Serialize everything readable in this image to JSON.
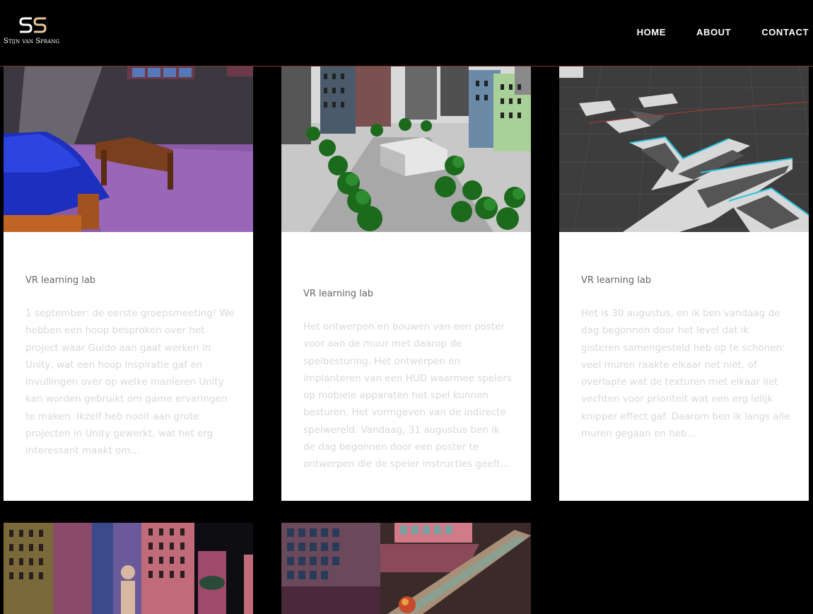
{
  "site": {
    "logo_mark": "SS",
    "name": "Stijn van Sprang"
  },
  "nav": {
    "items": [
      {
        "label": "HOME"
      },
      {
        "label": "ABOUT"
      },
      {
        "label": "CONTACT"
      }
    ]
  },
  "posts": [
    {
      "category": "VR learning lab",
      "excerpt": "1 september: de eerste groepsmeeting! We hebben een hoop besproken over het project waar Guido aan gaat werken in Unity, wat een hoop inspiratie gaf en invullingen over op welke manieren Unity kan worden gebruikt om game ervaringen te maken. Ikzelf heb nooit aan grote projecten in Unity gewerkt, wat het erg interessant maakt om…"
    },
    {
      "category": "VR learning lab",
      "excerpt": "Het ontwerpen en bouwen van een poster voor aan de muur met daarop de spelbesturing. Het ontwerpen en implanteren van een HUD waarmee spelers op mobiele apparaten het spel kunnen besturen. Het vormgeven van de indirecte spelwereld. Vandaag, 31 augustus ben ik de dag begonnen door een poster te ontwerpen die de speler instructies geeft…"
    },
    {
      "category": "VR learning lab",
      "excerpt": "Het is 30 augustus, en ik ben vandaag de dag begonnen door het level dat ik gisteren samengesteld heb op te schonen: veel muren raakte elkaar net niet, of overlapte wat de texturen met elkaar liet vechten voor prioriteit wat een erg lelijk knipper effect gaf. Daarom ben ik langs alle muren gegaan en heb…"
    }
  ],
  "colors": {
    "background": "#000000",
    "card": "#ffffff",
    "category_text": "#666666",
    "excerpt_text": "#d8d8d8",
    "header_rule": "#7a3a2a"
  }
}
